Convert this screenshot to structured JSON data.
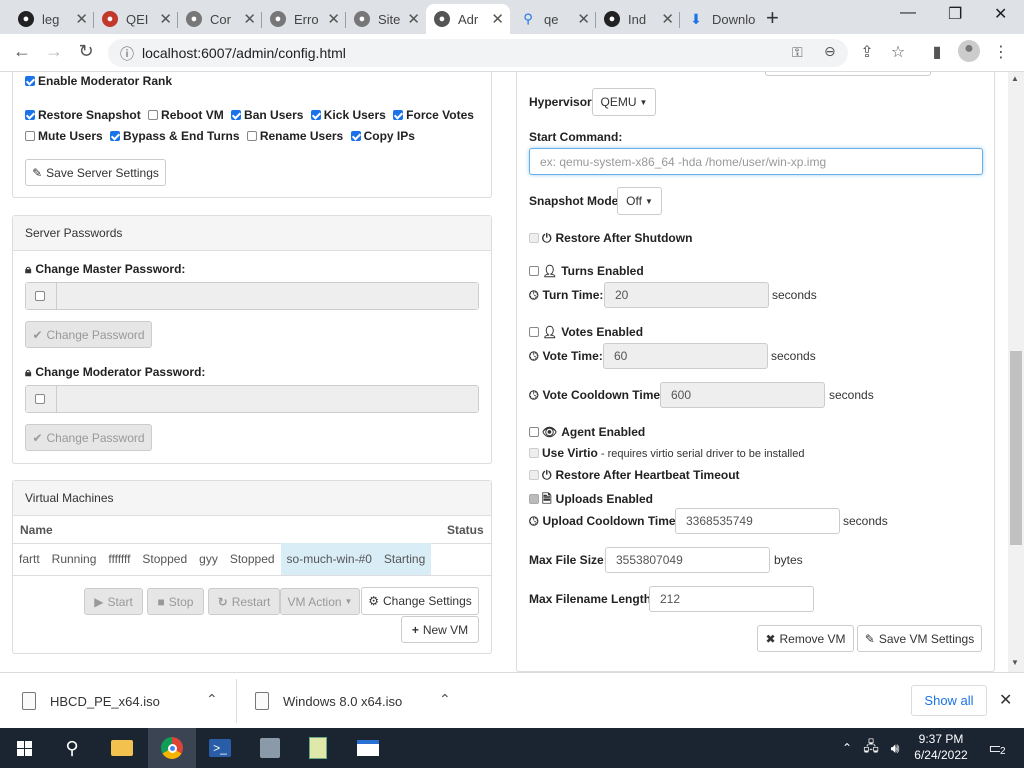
{
  "browser": {
    "tabs": [
      {
        "title": "leg",
        "favicon": "github-icon"
      },
      {
        "title": "QEI",
        "favicon": "qemu-icon"
      },
      {
        "title": "Cor",
        "favicon": "globe-icon"
      },
      {
        "title": "Erro",
        "favicon": "globe-icon"
      },
      {
        "title": "Site",
        "favicon": "globe-icon"
      },
      {
        "title": "Adr",
        "favicon": "globe-icon"
      },
      {
        "title": "qe",
        "favicon": "search-icon"
      },
      {
        "title": "Ind",
        "favicon": "github-icon"
      },
      {
        "title": "Downlo",
        "favicon": "download-icon"
      }
    ],
    "url": "localhost:6007/admin/config.html"
  },
  "left": {
    "mod_rank_label": "Enable Moderator Rank",
    "perms": [
      {
        "label": "Restore Snapshot",
        "checked": true
      },
      {
        "label": "Reboot VM",
        "checked": false
      },
      {
        "label": "Ban Users",
        "checked": true
      },
      {
        "label": "Kick Users",
        "checked": true
      },
      {
        "label": "Force Votes",
        "checked": true
      },
      {
        "label": "Mute Users",
        "checked": false
      },
      {
        "label": "Bypass & End Turns",
        "checked": true
      },
      {
        "label": "Rename Users",
        "checked": false
      },
      {
        "label": "Copy IPs",
        "checked": true
      }
    ],
    "save_server_label": "Save Server Settings",
    "passwords_heading": "Server Passwords",
    "master_pw_label": "Change Master Password:",
    "mod_pw_label": "Change Moderator Password:",
    "change_pw_label": "Change Password",
    "vm_heading": "Virtual Machines",
    "col_name": "Name",
    "col_status": "Status",
    "vms": [
      {
        "name": "fartt",
        "status": "Running"
      },
      {
        "name": "fffffff",
        "status": "Stopped"
      },
      {
        "name": "gyy",
        "status": "Stopped"
      },
      {
        "name": "so-much-win-#0",
        "status": "Starting"
      }
    ],
    "btn_start": "Start",
    "btn_stop": "Stop",
    "btn_restart": "Restart",
    "btn_vm_action": "VM Action",
    "btn_change_settings": "Change Settings",
    "btn_new_vm": "New VM"
  },
  "right": {
    "hypervisor_label": "Hypervisor:",
    "hypervisor_value": "QEMU",
    "start_cmd_label": "Start Command:",
    "start_cmd_placeholder": "ex: qemu-system-x86_64 -hda /home/user/win-xp.img",
    "snapshot_label": "Snapshot Mode:",
    "snapshot_value": "Off",
    "restore_shutdown_label": "Restore After Shutdown",
    "turns_label": "Turns Enabled",
    "turn_time_label": "Turn Time:",
    "turn_time_value": "20",
    "votes_label": "Votes Enabled",
    "vote_time_label": "Vote Time:",
    "vote_time_value": "60",
    "vote_cooldown_label": "Vote Cooldown Time:",
    "vote_cooldown_value": "600",
    "seconds": "seconds",
    "agent_label": "Agent Enabled",
    "use_virtio_label": "Use Virtio",
    "use_virtio_note": " - requires virtio serial driver to be installed",
    "restore_heartbeat_label": "Restore After Heartbeat Timeout",
    "uploads_label": "Uploads Enabled",
    "upload_cooldown_label": "Upload Cooldown Time:",
    "upload_cooldown_value": "3368535749",
    "max_file_label": "Max File Size:",
    "max_file_value": "3553807049",
    "bytes": "bytes",
    "max_filename_label": "Max Filename Length:",
    "max_filename_value": "212",
    "remove_vm": "Remove VM",
    "save_vm": "Save VM Settings"
  },
  "downloads": {
    "items": [
      "HBCD_PE_x64.iso",
      "Windows 8.0 x64.iso"
    ],
    "show_all": "Show all"
  },
  "taskbar": {
    "time": "9:37 PM",
    "date": "6/24/2022",
    "notif_count": "2"
  }
}
